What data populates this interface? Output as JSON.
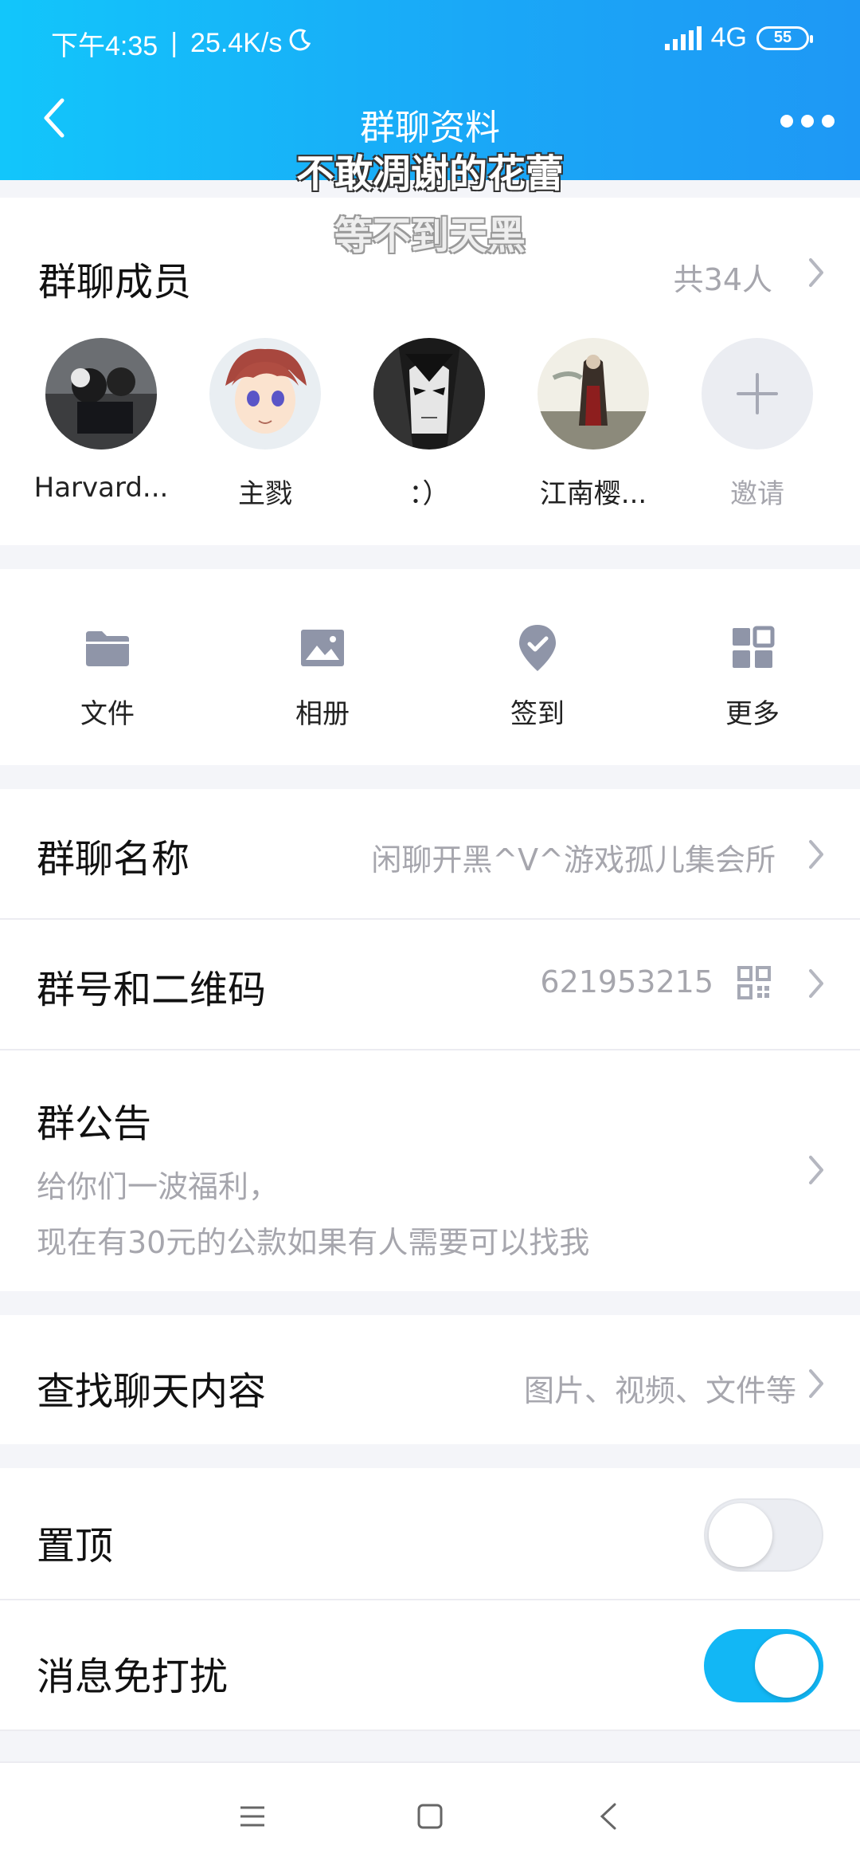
{
  "status_bar": {
    "time": "下午4:35",
    "speed": "25.4K/s",
    "network": "4G",
    "battery": "55"
  },
  "header": {
    "title": "群聊资料"
  },
  "lyrics": {
    "line1": "不敢凋谢的花蕾",
    "line2": "等不到天黑"
  },
  "members": {
    "title": "群聊成员",
    "count": "共34人",
    "items": [
      {
        "name": "Harvard..."
      },
      {
        "name": "主戮"
      },
      {
        "name": "：）"
      },
      {
        "name": "江南樱..."
      }
    ],
    "invite_label": "邀请"
  },
  "tools": {
    "files": "文件",
    "album": "相册",
    "checkin": "签到",
    "more": "更多"
  },
  "group_name": {
    "label": "群聊名称",
    "value": "闲聊开黑^V^游戏孤儿集会所"
  },
  "group_id": {
    "label": "群号和二维码",
    "value": "621953215"
  },
  "notice": {
    "label": "群公告",
    "line1": "给你们一波福利，",
    "line2": "现在有30元的公款如果有人需要可以找我"
  },
  "search_chat": {
    "label": "查找聊天内容",
    "hint": "图片、视频、文件等"
  },
  "pin_top": {
    "label": "置顶",
    "on": false
  },
  "mute": {
    "label": "消息免打扰",
    "on": true
  },
  "colors": {
    "accent": "#12b7f5",
    "header_gradient_start": "#12c6fb",
    "header_gradient_end": "#1e98f5",
    "secondary_text": "#a6a6ad",
    "icon_gray": "#8f95a8"
  }
}
